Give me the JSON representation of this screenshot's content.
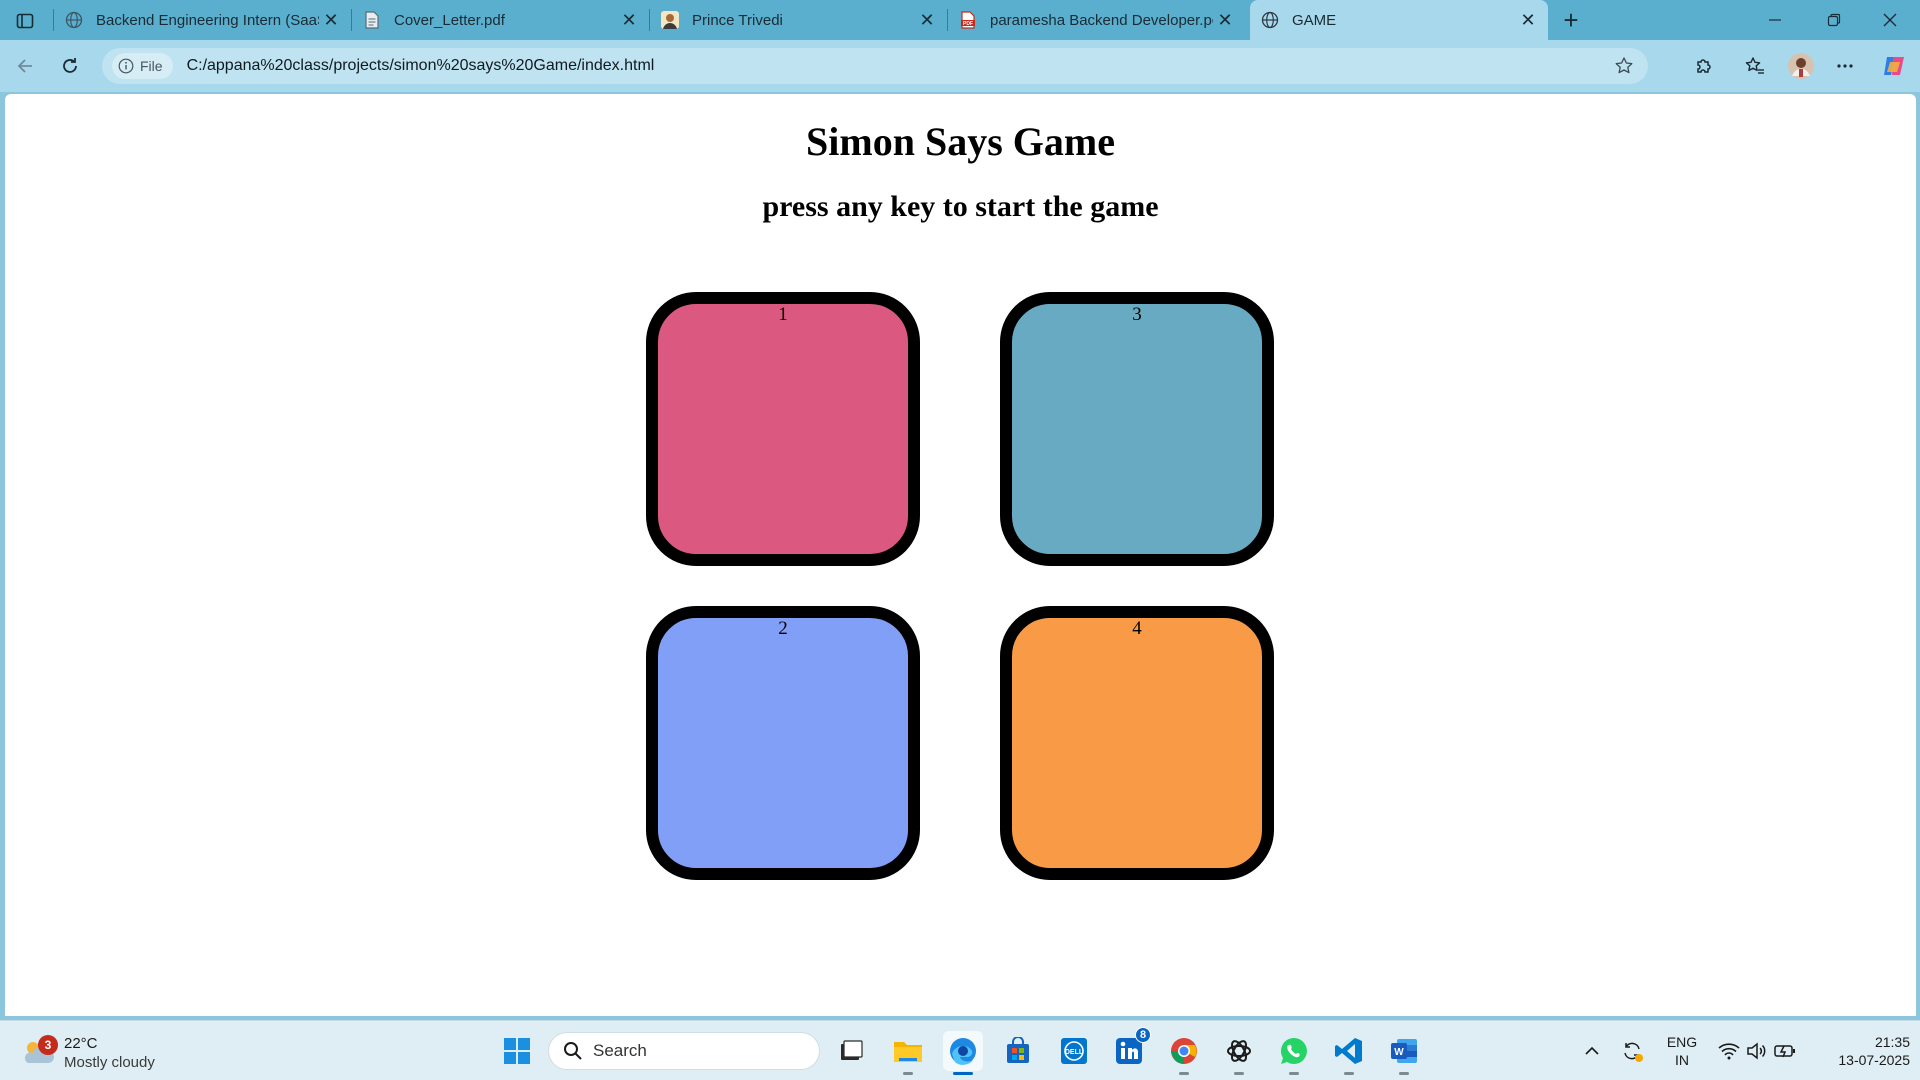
{
  "browser": {
    "tabs": [
      {
        "title": "Backend Engineering Intern (SaaS",
        "favicon": "globe-icon",
        "active": false
      },
      {
        "title": "Cover_Letter.pdf",
        "favicon": "document-icon",
        "active": false
      },
      {
        "title": "Prince Trivedi",
        "favicon": "profile-photo-icon",
        "active": false
      },
      {
        "title": "paramesha Backend Developer.pc",
        "favicon": "pdf-icon",
        "active": false
      },
      {
        "title": "GAME",
        "favicon": "globe-icon",
        "active": true
      }
    ],
    "address": {
      "chip_label": "File",
      "url": "C:/appana%20class/projects/simon%20says%20Game/index.html"
    }
  },
  "page": {
    "title": "Simon Says Game",
    "subtitle": "press any key to start the game",
    "buttons": [
      {
        "label": "1",
        "color": "#db5980"
      },
      {
        "label": "2",
        "color": "#829ff8"
      },
      {
        "label": "3",
        "color": "#69aac3"
      },
      {
        "label": "4",
        "color": "#f89a46"
      }
    ]
  },
  "taskbar": {
    "weather": {
      "badge": "3",
      "temp": "22°C",
      "condition": "Mostly cloudy"
    },
    "search_label": "Search",
    "linkedin_badge": "8",
    "language": {
      "line1": "ENG",
      "line2": "IN"
    },
    "clock": {
      "time": "21:35",
      "date": "13-07-2025"
    }
  }
}
